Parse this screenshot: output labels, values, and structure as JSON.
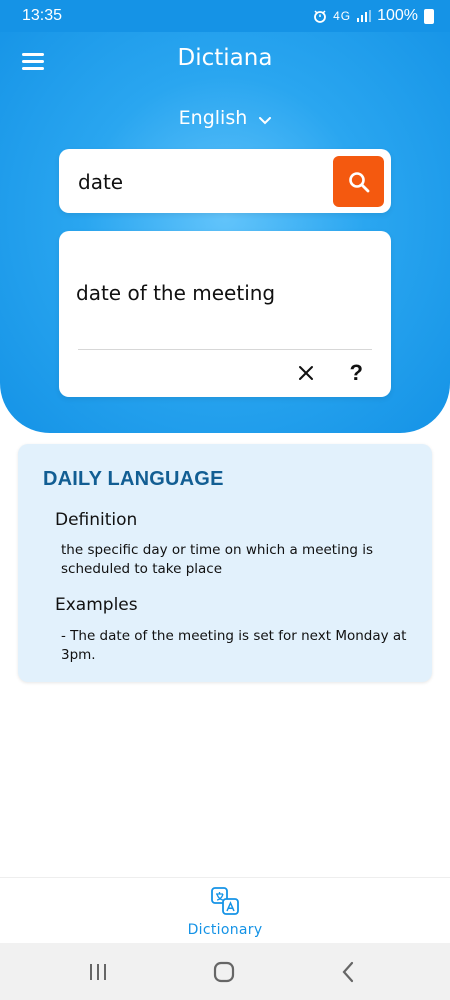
{
  "status_bar": {
    "time": "13:35",
    "network": "4G",
    "battery": "100%"
  },
  "header": {
    "title": "Dictiana",
    "language": "English"
  },
  "search": {
    "value": "date"
  },
  "result": {
    "text": "date of the meeting"
  },
  "daily": {
    "title": "DAILY LANGUAGE",
    "definition_heading": "Definition",
    "definition_text": "the specific day or time on which a meeting is scheduled to take place",
    "examples_heading": "Examples",
    "examples_text": "- The date of the meeting is set for next Monday at 3pm."
  },
  "bottom_nav": {
    "label": "Dictionary"
  },
  "colors": {
    "accent": "#1593e6",
    "search_button": "#f4590f",
    "card_bg": "#e2f1fc",
    "heading": "#125e93"
  },
  "icons": {
    "menu": "hamburger-menu-icon",
    "chevron": "chevron-down-icon",
    "search": "search-icon",
    "clear": "close-icon",
    "help": "question-icon",
    "dictionary": "translate-icon"
  }
}
